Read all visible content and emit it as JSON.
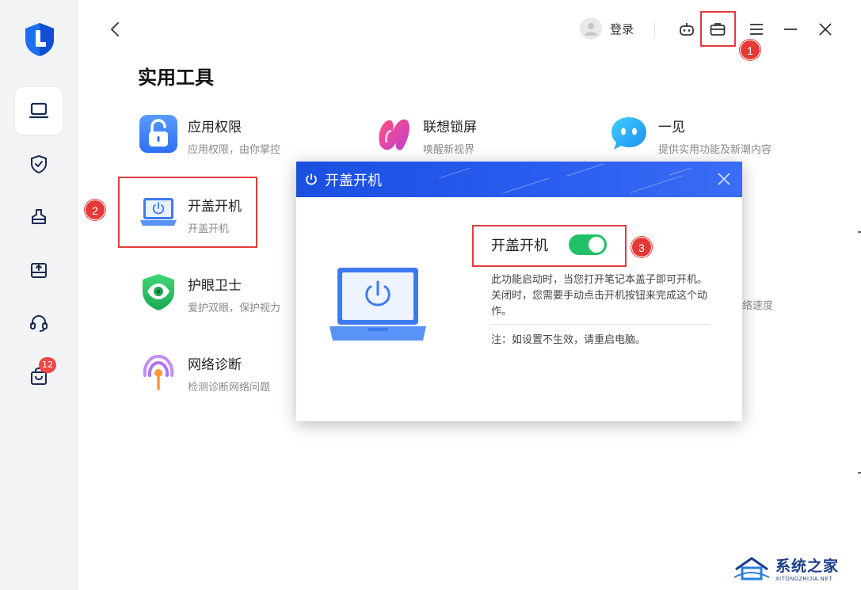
{
  "sidebar": {
    "items": [
      {
        "icon": "laptop-icon",
        "active": true
      },
      {
        "icon": "shield-check-icon",
        "active": false
      },
      {
        "icon": "cleaning-brush-icon",
        "active": false
      },
      {
        "icon": "upload-drive-icon",
        "active": false
      },
      {
        "icon": "headset-icon",
        "active": false
      },
      {
        "icon": "shopping-bag-icon",
        "active": false,
        "badge": "12"
      }
    ]
  },
  "topbar": {
    "login_label": "登录",
    "icons": [
      "robot-icon",
      "toolbox-icon",
      "menu-icon",
      "minimize-icon",
      "close-icon"
    ]
  },
  "page": {
    "title": "实用工具"
  },
  "tools": [
    {
      "name": "应用权限",
      "desc": "应用权限，由你掌控",
      "icon": "lock-icon"
    },
    {
      "name": "联想锁屏",
      "desc": "唤醒新视界",
      "icon": "lenovo-lockscreen-icon"
    },
    {
      "name": "一见",
      "desc": "提供实用功能及新潮内容",
      "icon": "chat-bubble-icon"
    },
    {
      "name": "开盖开机",
      "desc": "开盖开机",
      "icon": "laptop-power-icon"
    },
    {
      "name": "护眼卫士",
      "desc": "爱护双眼，保护视力",
      "icon": "eye-shield-icon"
    },
    {
      "name": "网络诊断",
      "desc": "检测诊断网络问题",
      "icon": "wifi-signal-icon"
    }
  ],
  "hidden_tool_desc_clip": "络速度",
  "dialog": {
    "title": "开盖开机",
    "toggle_label": "开盖开机",
    "toggle_on": true,
    "description": "此功能启动时，当您打开笔记本盖子即可开机。关闭时，您需要手动点击开机按钮来完成这个动作。",
    "note": "注：如设置不生效，请重启电脑。"
  },
  "annotations": {
    "callout_1": "1",
    "callout_2": "2",
    "callout_3": "3"
  },
  "watermark": {
    "cn": "系统之家",
    "en": "XITONGZHIJIA.NET"
  },
  "colors": {
    "accent_blue": "#2a5cef",
    "toggle_green": "#22c066",
    "highlight_red": "#e23c3c",
    "badge_red": "#f04848"
  }
}
